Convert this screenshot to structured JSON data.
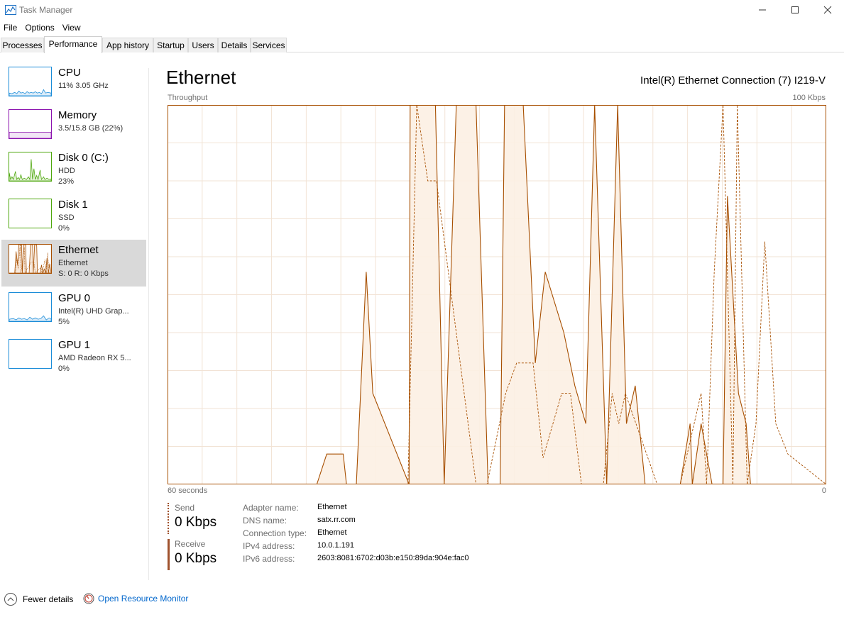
{
  "window": {
    "title": "Task Manager"
  },
  "menu": [
    "File",
    "Options",
    "View"
  ],
  "tabs": [
    "Processes",
    "Performance",
    "App history",
    "Startup",
    "Users",
    "Details",
    "Services"
  ],
  "active_tab": "Performance",
  "sidebar": [
    {
      "name": "CPU",
      "sub1": "11% 3.05 GHz",
      "sub2": "",
      "color": "#1a8cd8",
      "icon": "cpu-graph"
    },
    {
      "name": "Memory",
      "sub1": "3.5/15.8 GB (22%)",
      "sub2": "",
      "color": "#8b12ae",
      "icon": "memory-graph"
    },
    {
      "name": "Disk 0 (C:)",
      "sub1": "HDD",
      "sub2": "23%",
      "color": "#4da60c",
      "icon": "disk-graph"
    },
    {
      "name": "Disk 1",
      "sub1": "SSD",
      "sub2": "0%",
      "color": "#4da60c",
      "icon": "disk-graph"
    },
    {
      "name": "Ethernet",
      "sub1": "Ethernet",
      "sub2": "S: 0 R: 0 Kbps",
      "color": "#a74f01",
      "icon": "ethernet-graph",
      "selected": true
    },
    {
      "name": "GPU 0",
      "sub1": "Intel(R) UHD Grap...",
      "sub2": "5%",
      "color": "#1a8cd8",
      "icon": "gpu-graph"
    },
    {
      "name": "GPU 1",
      "sub1": "AMD Radeon RX 5...",
      "sub2": "0%",
      "color": "#1a8cd8",
      "icon": "gpu-graph"
    }
  ],
  "main": {
    "title": "Ethernet",
    "adapter": "Intel(R) Ethernet Connection (7) I219-V",
    "graph_label": "Throughput",
    "graph_max": "100 Kbps",
    "time_left": "60 seconds",
    "time_right": "0"
  },
  "chart_data": {
    "type": "area",
    "title": "Throughput",
    "xlabel": "60 seconds",
    "ylabel": "",
    "ylim": [
      0,
      100
    ],
    "xlim": [
      60,
      0
    ],
    "grid": true,
    "series": [
      {
        "name": "Receive",
        "style": "solid",
        "color": "#a74f01",
        "x": [
          60,
          57,
          56,
          54,
          53,
          51,
          50,
          49,
          48.7,
          48,
          46.4,
          45.5,
          44,
          43.7,
          43.4,
          42.8,
          41.9,
          41.3,
          38,
          37.9,
          37.4,
          36.6,
          35.6,
          34.8,
          33.7,
          32.8,
          32.1,
          31.9,
          30.8,
          30.7,
          29.7,
          29.3,
          28.4,
          27.6,
          26.5,
          25.6,
          23.9,
          22.9,
          21.9,
          21.1,
          20,
          19,
          18.2,
          17.4,
          16.5,
          15.9,
          15.5,
          15.4,
          14.4,
          13.4,
          13.3,
          12.4,
          12.2,
          11.4,
          10.4,
          9.4,
          9,
          8,
          7.3,
          6.9,
          5.8,
          5.3,
          4.9,
          4.3,
          3.9,
          3,
          2,
          1,
          0
        ],
        "y": [
          0,
          0,
          0,
          0,
          0,
          0,
          0,
          0,
          0,
          0,
          0,
          8,
          8,
          0,
          0,
          0,
          56,
          24,
          0,
          100,
          100,
          100,
          100,
          0,
          100,
          100,
          100,
          100,
          0,
          0,
          0,
          100,
          100,
          100,
          32,
          56,
          40,
          26,
          16,
          100,
          0,
          100,
          16,
          26,
          0,
          0,
          0,
          0,
          0,
          0,
          0,
          16,
          0,
          16,
          0,
          0,
          76,
          24,
          16,
          0,
          0,
          0,
          0,
          0,
          0,
          0,
          0,
          0,
          0
        ]
      },
      {
        "name": "Send",
        "style": "dashed",
        "color": "#a74f01",
        "x": [
          60,
          49.9,
          48.3,
          44.7,
          43.3,
          42.9,
          41.7,
          38.1,
          37.3,
          36.3,
          35.5,
          31.9,
          30.9,
          29.2,
          28.2,
          26.7,
          25.8,
          24.1,
          23.3,
          22.3,
          21.2,
          20.3,
          19.5,
          18.9,
          18.3,
          15.4,
          13.3,
          11.4,
          10.9,
          10.2,
          9.4,
          8.5,
          8.1,
          7.2,
          6.4,
          5.6,
          4.6,
          3.5,
          0
        ],
        "y": [
          0,
          0,
          0,
          0,
          0,
          0,
          0,
          0,
          100,
          80,
          80,
          0,
          0,
          24,
          32,
          32,
          7,
          24,
          24,
          0,
          0,
          0,
          24,
          16,
          24,
          0,
          0,
          24,
          0,
          56,
          100,
          0,
          100,
          0,
          16,
          64,
          16,
          8,
          0
        ]
      }
    ]
  },
  "stats": {
    "send_label": "Send",
    "send_value": "0 Kbps",
    "recv_label": "Receive",
    "recv_value": "0 Kbps"
  },
  "properties": [
    {
      "key": "Adapter name:",
      "value": "Ethernet"
    },
    {
      "key": "DNS name:",
      "value": "satx.rr.com"
    },
    {
      "key": "Connection type:",
      "value": "Ethernet"
    },
    {
      "key": "IPv4 address:",
      "value": "10.0.1.191"
    },
    {
      "key": "IPv6 address:",
      "value": "2603:8081:6702:d03b:e150:89da:904e:fac0"
    }
  ],
  "footer": {
    "fewer_details": "Fewer details",
    "resource_monitor": "Open Resource Monitor"
  }
}
